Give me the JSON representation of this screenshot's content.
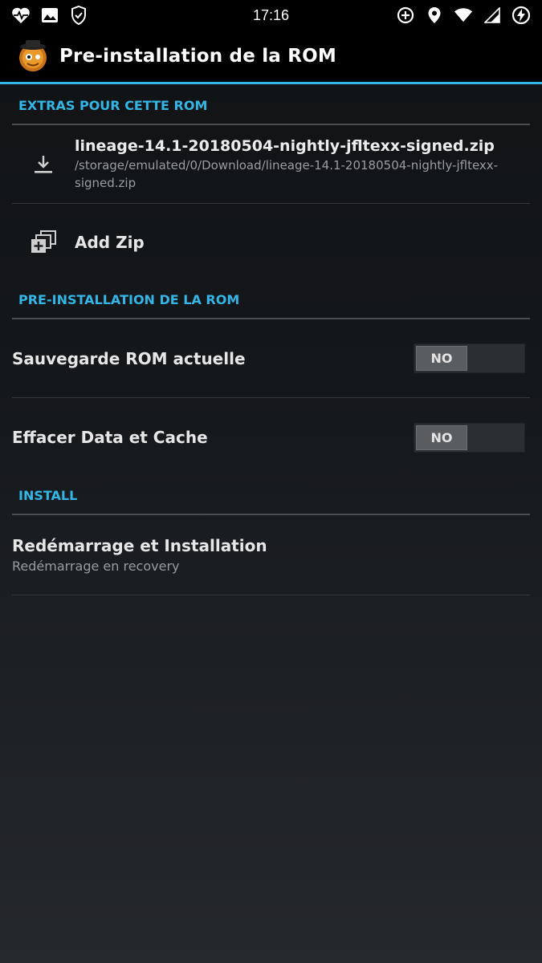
{
  "statusbar": {
    "time": "17:16",
    "left_icons": [
      "heartbeat-icon",
      "image-icon",
      "shield-check-icon"
    ],
    "right_icons": [
      "data-saver-icon",
      "location-icon",
      "wifi-icon",
      "signal-icon",
      "battery-charging-icon"
    ]
  },
  "actionbar": {
    "title": "Pre-installation de la ROM",
    "app_icon": "clockworkmod-logo"
  },
  "sections": {
    "extras": {
      "header": "EXTRAS POUR CETTE ROM",
      "file": {
        "name": "lineage-14.1-20180504-nightly-jfltexx-signed.zip",
        "path": "/storage/emulated/0/Download/lineage-14.1-20180504-nightly-jfltexx-signed.zip",
        "icon": "download-icon"
      },
      "add_zip": {
        "label": "Add Zip",
        "icon": "add-zip-icon"
      }
    },
    "preinstall": {
      "header": "PRE-INSTALLATION DE LA ROM",
      "backup": {
        "label": "Sauvegarde ROM actuelle",
        "state": "NO"
      },
      "wipe": {
        "label": "Effacer Data et Cache",
        "state": "NO"
      }
    },
    "install": {
      "header": "INSTALL",
      "reboot": {
        "title": "Redémarrage et Installation",
        "subtitle": "Redémarrage en recovery"
      }
    }
  },
  "colors": {
    "accent": "#33b5e5",
    "actionbar": "#000000",
    "toggle_off": "#5a5d60"
  }
}
